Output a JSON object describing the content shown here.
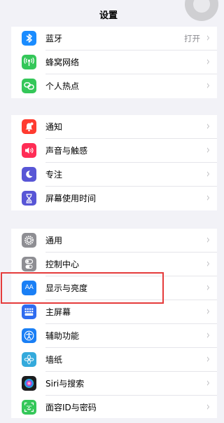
{
  "header": {
    "title": "设置"
  },
  "groups": [
    {
      "items": [
        {
          "label": "蓝牙",
          "value": "打开",
          "icon": "bluetooth-icon",
          "color": "#1a8cff"
        },
        {
          "label": "蜂窝网络",
          "value": "",
          "icon": "cellular-icon",
          "color": "#34c759"
        },
        {
          "label": "个人热点",
          "value": "",
          "icon": "hotspot-icon",
          "color": "#34c759"
        }
      ]
    },
    {
      "items": [
        {
          "label": "通知",
          "value": "",
          "icon": "bell-icon",
          "color": "#ff3b30"
        },
        {
          "label": "声音与触感",
          "value": "",
          "icon": "speaker-icon",
          "color": "#ff2d55"
        },
        {
          "label": "专注",
          "value": "",
          "icon": "moon-icon",
          "color": "#5856d6"
        },
        {
          "label": "屏幕使用时间",
          "value": "",
          "icon": "hourglass-icon",
          "color": "#5856d6"
        }
      ]
    },
    {
      "items": [
        {
          "label": "通用",
          "value": "",
          "icon": "gear-icon",
          "color": "#8e8e93"
        },
        {
          "label": "控制中心",
          "value": "",
          "icon": "toggle-icon",
          "color": "#8e8e93"
        },
        {
          "label": "显示与亮度",
          "value": "",
          "icon": "text-size-icon",
          "color": "#1a7ff5"
        },
        {
          "label": "主屏幕",
          "value": "",
          "icon": "grid-icon",
          "color": "#2f6cf0"
        },
        {
          "label": "辅助功能",
          "value": "",
          "icon": "accessibility-icon",
          "color": "#1a7ff5"
        },
        {
          "label": "墙纸",
          "value": "",
          "icon": "flower-icon",
          "color": "#34aadc"
        },
        {
          "label": "Siri与搜索",
          "value": "",
          "icon": "siri-icon",
          "color": "#1c1c1e"
        },
        {
          "label": "面容ID与密码",
          "value": "",
          "icon": "faceid-icon",
          "color": "#34c759"
        }
      ]
    }
  ],
  "icon_glyph": {
    "text_size": "AA"
  },
  "highlight_color": "#e53b3b"
}
